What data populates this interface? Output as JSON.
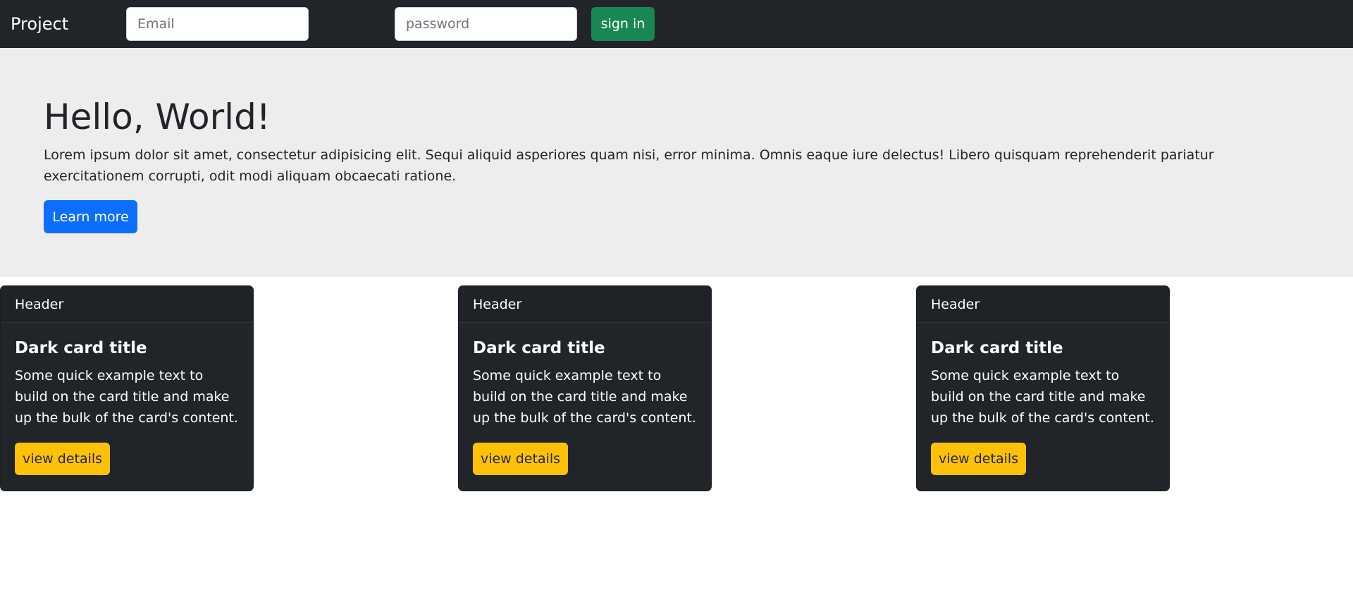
{
  "navbar": {
    "brand": "Project",
    "email_placeholder": "Email",
    "password_placeholder": "password",
    "signin_label": "sign in"
  },
  "hero": {
    "title": "Hello, World!",
    "text": "Lorem ipsum dolor sit amet, consectetur adipisicing elit. Sequi aliquid asperiores quam nisi, error minima. Omnis eaque iure delectus! Libero quisquam reprehenderit pariatur exercitationem corrupti, odit modi aliquam obcaecati ratione.",
    "button_label": "Learn more"
  },
  "cards": [
    {
      "header": "Header",
      "title": "Dark card title",
      "text": "Some quick example text to build on the card title and make up the bulk of the card's content.",
      "button_label": "view details"
    },
    {
      "header": "Header",
      "title": "Dark card title",
      "text": "Some quick example text to build on the card title and make up the bulk of the card's content.",
      "button_label": "view details"
    },
    {
      "header": "Header",
      "title": "Dark card title",
      "text": "Some quick example text to build on the card title and make up the bulk of the card's content.",
      "button_label": "view details"
    }
  ],
  "colors": {
    "navbar_bg": "#212529",
    "hero_bg": "#ededed",
    "primary": "#0d6efd",
    "success": "#198754",
    "warning": "#ffc107"
  }
}
